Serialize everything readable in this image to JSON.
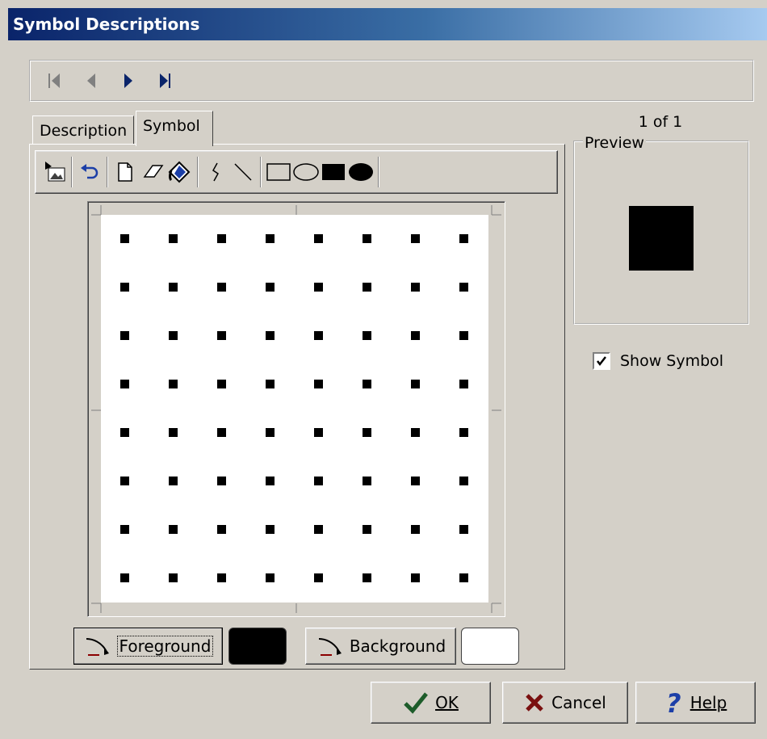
{
  "window": {
    "title": "Symbol Descriptions"
  },
  "navigator": {
    "buttons": [
      "first-record",
      "previous-record",
      "next-record",
      "last-record"
    ],
    "record_label": "1 of 1"
  },
  "tabs": [
    {
      "label": "Description",
      "active": false
    },
    {
      "label": "Symbol",
      "active": true
    }
  ],
  "toolbar": {
    "tools": [
      "import-image-icon",
      "undo-icon",
      "new-icon",
      "eraser-icon",
      "fill-icon",
      "freehand-icon",
      "line-icon",
      "rectangle-icon",
      "ellipse-icon",
      "filled-rectangle-icon",
      "filled-ellipse-icon"
    ]
  },
  "canvas": {
    "pattern": "dot-grid",
    "rows": 8,
    "columns": 8,
    "foreground_color": "#000000",
    "background_color": "#ffffff"
  },
  "colors": {
    "foreground_label": "Foreground",
    "background_label": "Background",
    "foreground_swatch": "#000000",
    "background_swatch": "#ffffff"
  },
  "preview": {
    "label": "Preview",
    "symbol_color": "#000000"
  },
  "show_symbol": {
    "label": "Show Symbol",
    "checked": true
  },
  "buttons": {
    "ok": "OK",
    "cancel": "Cancel",
    "help": "Help"
  }
}
